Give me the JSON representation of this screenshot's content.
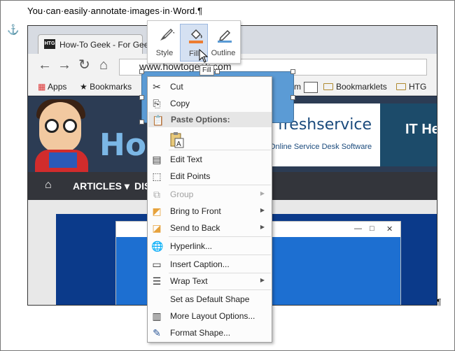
{
  "document": {
    "text": "You·can·easily·annotate·images·in·Word.¶",
    "end_mark": "¶"
  },
  "browser": {
    "tab_favicon": "HTG",
    "tab_title": "How-To Geek - For Gee",
    "url": "www.howtogeek.com",
    "bookmarks": {
      "apps": "Apps",
      "bookmarks": "Bookmarks",
      "bookmarklets": "Bookmarklets",
      "htg": "HTG",
      "partial": "m"
    }
  },
  "website": {
    "logo_text": "How",
    "ad_brand": "freshservice",
    "ad_sub": "Online Service Desk Software",
    "ad_dark_text": "IT He",
    "menu": [
      "ARTICLES ▾",
      "DIS"
    ]
  },
  "mini_toolbar": {
    "style_label": "Style",
    "fill_label": "Fill",
    "outline_label": "Outline",
    "tooltip": "Fill",
    "colors": {
      "fill_orange": "#ed7d31",
      "outline_blue": "#5b9bd5"
    }
  },
  "context_menu": {
    "cut": "Cut",
    "copy": "Copy",
    "paste_options": "Paste Options:",
    "edit_text": "Edit Text",
    "edit_points": "Edit Points",
    "group": "Group",
    "bring_to_front": "Bring to Front",
    "send_to_back": "Send to Back",
    "hyperlink": "Hyperlink...",
    "insert_caption": "Insert Caption...",
    "wrap_text": "Wrap Text",
    "set_default": "Set as Default Shape",
    "more_layout": "More Layout Options...",
    "format_shape": "Format Shape..."
  }
}
